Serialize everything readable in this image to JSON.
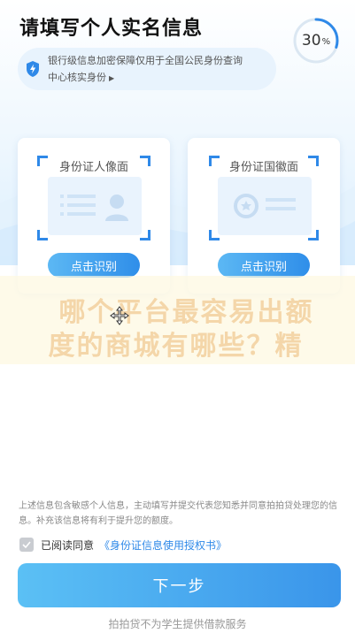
{
  "header": {
    "title": "请填写个人实名信息",
    "progress_value": "30",
    "progress_unit": "%",
    "progress_fraction": 0.3,
    "accent_color": "#2f89e8"
  },
  "notice": {
    "icon": "shield-lightning-icon",
    "line1": "银行级信息加密保障仅用于全国公民身份查询",
    "line2": "中心核实身份"
  },
  "cards": [
    {
      "label": "身份证人像面",
      "button": "点击识别",
      "art": "id-portrait-side"
    },
    {
      "label": "身份证国徽面",
      "button": "点击识别",
      "art": "id-emblem-side"
    }
  ],
  "watermark": {
    "line1": "哪个平台最容易出额",
    "line2": "度的商城有哪些？精"
  },
  "footer": {
    "disclaimer": "上述信息包含敏感个人信息，主动填写并提交代表您知悉并同意拍拍贷处理您的信息。补充该信息将有利于提升您的额度。",
    "agree_text": "已阅读同意",
    "agree_link": "《身份证信息使用授权书》",
    "next_button": "下一步",
    "note": "拍拍贷不为学生提供借款服务"
  }
}
